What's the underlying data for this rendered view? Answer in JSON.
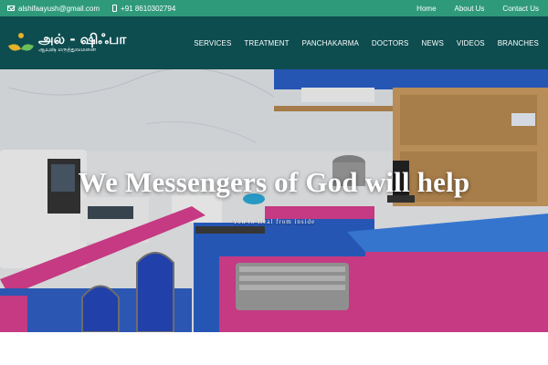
{
  "topbar": {
    "email": "alshifaayush@gmail.com",
    "phone": "+91 8610302794",
    "links": [
      "Home",
      "About Us",
      "Contact Us"
    ],
    "bg_color": "#2f9a7a"
  },
  "header": {
    "logo_title": "அல் - ஷிஃபா",
    "logo_subtitle": "ஆயுஷ் மருத்துவமனை",
    "nav": [
      "SERVICES",
      "TREATMENT",
      "PANCHAKARMA",
      "DOCTORS",
      "NEWS",
      "VIDEOS",
      "BRANCHES"
    ],
    "bg_color": "#0d4c4f"
  },
  "hero": {
    "title": "We Messengers of God will help",
    "subtitle": "You to Heal from inside"
  },
  "colors": {
    "counter_pink": "#d63f8e",
    "counter_blue": "#2f6fcf",
    "cabinet_blue": "#2a5ec4"
  },
  "icons": [
    "mail-icon",
    "phone-icon",
    "logo-icon"
  ]
}
